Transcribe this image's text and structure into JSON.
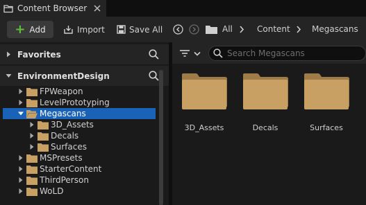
{
  "tab": {
    "title": "Content Browser",
    "icon": "content-browser-icon",
    "close_icon": "close-icon"
  },
  "toolbar": {
    "add_label": "Add",
    "import_label": "Import",
    "save_all_label": "Save All",
    "breadcrumbs": [
      "All",
      "Content",
      "Megascans"
    ]
  },
  "sidebar": {
    "favorites_label": "Favorites",
    "environment_label": "EnvironmentDesign",
    "tree": [
      {
        "label": "FPWeapon",
        "depth": 0,
        "expanded": false,
        "selected": false
      },
      {
        "label": "LevelPrototyping",
        "depth": 0,
        "expanded": false,
        "selected": false
      },
      {
        "label": "Megascans",
        "depth": 0,
        "expanded": true,
        "selected": true
      },
      {
        "label": "3D_Assets",
        "depth": 1,
        "expanded": false,
        "selected": false
      },
      {
        "label": "Decals",
        "depth": 1,
        "expanded": false,
        "selected": false
      },
      {
        "label": "Surfaces",
        "depth": 1,
        "expanded": false,
        "selected": false
      },
      {
        "label": "MSPresets",
        "depth": 0,
        "expanded": false,
        "selected": false
      },
      {
        "label": "StarterContent",
        "depth": 0,
        "expanded": false,
        "selected": false
      },
      {
        "label": "ThirdPerson",
        "depth": 0,
        "expanded": false,
        "selected": false
      },
      {
        "label": "WoLD",
        "depth": 0,
        "expanded": false,
        "selected": false
      }
    ]
  },
  "content": {
    "search_placeholder": "Search Megascans",
    "folders": [
      "3D_Assets",
      "Decals",
      "Surfaces"
    ]
  },
  "colors": {
    "selection": "#1a62b8",
    "folder": "#c8a063",
    "add_plus": "#5fbf3a"
  }
}
